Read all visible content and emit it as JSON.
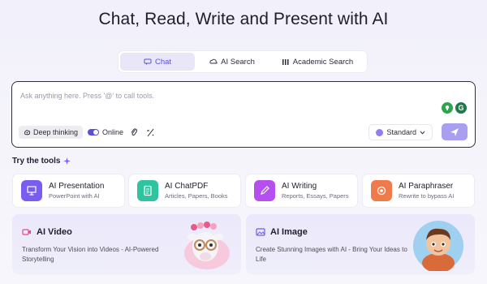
{
  "header": {
    "title": "Chat, Read, Write and Present with AI"
  },
  "tabs": [
    {
      "label": "Chat",
      "icon": "chat-bubble-icon"
    },
    {
      "label": "AI Search",
      "icon": "cloud-search-icon"
    },
    {
      "label": "Academic Search",
      "icon": "library-icon"
    }
  ],
  "chat": {
    "placeholder": "Ask anything here. Press '@' to call tools.",
    "deep_thinking": "Deep thinking",
    "online": "Online",
    "model": "Standard"
  },
  "tools_section": {
    "label": "Try the tools"
  },
  "tools": [
    {
      "title": "AI Presentation",
      "sub": "PowerPoint with AI",
      "color": "#7b5cf0"
    },
    {
      "title": "AI ChatPDF",
      "sub": "Articles, Papers, Books",
      "color": "#2fc3a0"
    },
    {
      "title": "AI Writing",
      "sub": "Reports, Essays, Papers",
      "color": "#b64ff0"
    },
    {
      "title": "AI Paraphraser",
      "sub": "Rewrite to bypass AI",
      "color": "#f07a4a"
    }
  ],
  "features": [
    {
      "title": "AI Video",
      "desc": "Transform Your Vision into Videos - AI-Powered Storytelling"
    },
    {
      "title": "AI Image",
      "desc": "Create Stunning Images with AI - Bring Your Ideas to Life"
    }
  ],
  "colors": {
    "accent": "#5b4fd6",
    "send": "#a99ff0"
  }
}
